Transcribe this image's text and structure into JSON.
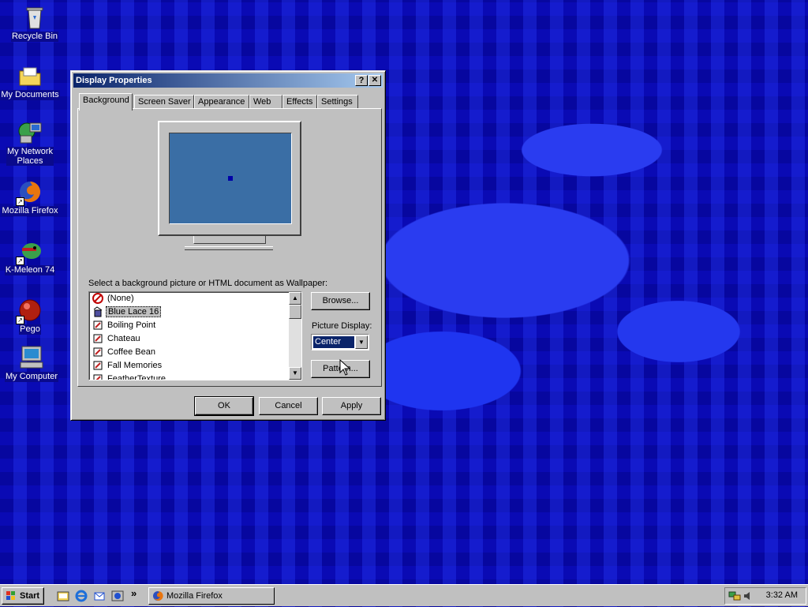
{
  "desktop": {
    "icons": [
      {
        "label": "Recycle Bin",
        "icon": "recycle-bin-icon"
      },
      {
        "label": "My Documents",
        "icon": "folder-icon"
      },
      {
        "label": "My Network Places",
        "icon": "network-places-icon"
      },
      {
        "label": "Mozilla Firefox",
        "icon": "firefox-icon"
      },
      {
        "label": "K-Meleon 74",
        "icon": "k-meleon-icon"
      },
      {
        "label": "Pego",
        "icon": "pego-icon"
      },
      {
        "label": "My Computer",
        "icon": "my-computer-icon"
      }
    ],
    "network_line1": "My Network",
    "network_line2": "Places"
  },
  "dialog": {
    "title": "Display Properties",
    "help_btn": "?",
    "close_btn": "✕",
    "tabs": [
      "Background",
      "Screen Saver",
      "Appearance",
      "Web",
      "Effects",
      "Settings"
    ],
    "active_tab": "Background",
    "wallpaper_label": "Select a background picture or HTML document as Wallpaper:",
    "wallpapers": [
      "(None)",
      "Blue Lace 16",
      "Boiling Point",
      "Chateau",
      "Coffee Bean",
      "Fall Memories",
      "FeatherTexture"
    ],
    "selected_wallpaper": "Blue Lace 16",
    "browse_label": "Browse...",
    "picture_display_label": "Picture Display:",
    "picture_display_value": "Center",
    "pattern_label": "Pattern...",
    "ok_label": "OK",
    "cancel_label": "Cancel",
    "apply_label": "Apply"
  },
  "taskbar": {
    "start_label": "Start",
    "quicklaunch_more": "»",
    "task_label": "Mozilla Firefox",
    "clock": "3:32 AM"
  },
  "colors": {
    "desktop_bg": "#0a0ab4",
    "title_gradient_start": "#0a246a",
    "preview_screen": "#3a6ea5"
  }
}
